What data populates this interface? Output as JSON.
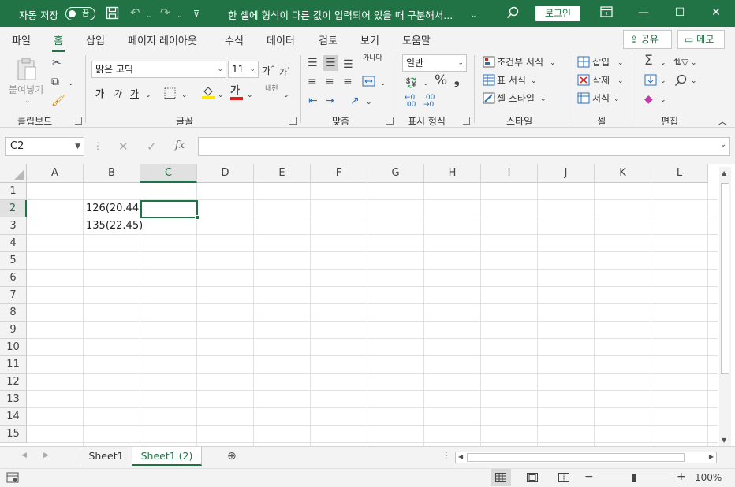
{
  "titlebar": {
    "autosave_label": "자동 저장",
    "autosave_state": "끔",
    "doc_title": "한 셀에 형식이 다른 값이 입력되어 있을 때 구분해서...",
    "login_label": "로그인"
  },
  "menu": {
    "tabs": [
      {
        "label": "파일"
      },
      {
        "label": "홈"
      },
      {
        "label": "삽입"
      },
      {
        "label": "페이지 레이아웃"
      },
      {
        "label": "수식"
      },
      {
        "label": "데이터"
      },
      {
        "label": "검토"
      },
      {
        "label": "보기"
      },
      {
        "label": "도움말"
      }
    ],
    "active_tab": "홈",
    "share_label": "공유",
    "memo_label": "메모"
  },
  "ribbon": {
    "clipboard": {
      "paste_label": "붙여넣기",
      "group_label": "클립보드"
    },
    "font": {
      "font_name": "맑은 고딕",
      "font_size": "11",
      "group_label": "글꼴",
      "bold": "가",
      "italic": "가",
      "underline": "가",
      "grow": "가",
      "shrink": "가",
      "color_letter": "가",
      "phonetic": "내천"
    },
    "alignment": {
      "group_label": "맞춤",
      "wrap": "가나다"
    },
    "number": {
      "format": "일반",
      "group_label": "표시 형식"
    },
    "styles": {
      "conditional": "조건부 서식",
      "table": "표 서식",
      "cell": "셀 스타일",
      "group_label": "스타일"
    },
    "cells": {
      "insert": "삽입",
      "delete": "삭제",
      "format": "서식",
      "group_label": "셀"
    },
    "editing": {
      "group_label": "편집"
    }
  },
  "formula_bar": {
    "name_box": "C2",
    "formula": "",
    "fx": "fx"
  },
  "grid": {
    "columns": [
      "A",
      "B",
      "C",
      "D",
      "E",
      "F",
      "G",
      "H",
      "I",
      "J",
      "K",
      "L"
    ],
    "rows": [
      "1",
      "2",
      "3",
      "4",
      "5",
      "6",
      "7",
      "8",
      "9",
      "10",
      "11",
      "12",
      "13",
      "14",
      "15"
    ],
    "selected_cell": "C2",
    "cells": {
      "B2": "126(20.44)",
      "B3": "135(22.45)"
    }
  },
  "sheets": {
    "tabs": [
      "Sheet1",
      "Sheet1 (2)"
    ],
    "active": "Sheet1 (2)"
  },
  "statusbar": {
    "zoom": "100%"
  },
  "colors": {
    "accent": "#217346"
  }
}
